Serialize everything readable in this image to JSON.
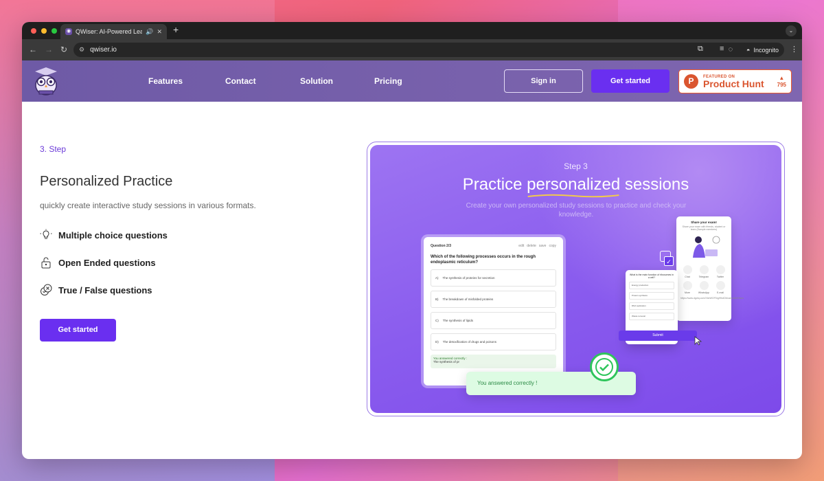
{
  "browser": {
    "tab_title": "QWiser: AI-Powered Learn",
    "url": "qwiser.io",
    "incognito_label": "Incognito"
  },
  "nav": {
    "links": [
      "Features",
      "Contact",
      "Solution",
      "Pricing"
    ],
    "signin": "Sign in",
    "get_started": "Get started",
    "product_hunt": {
      "featured": "FEATURED ON",
      "name": "Product Hunt",
      "votes": "795"
    }
  },
  "main": {
    "step": "3. Step",
    "title": "Personalized Practice",
    "description": "quickly create interactive study sessions in various formats.",
    "features": [
      "Multiple choice questions",
      "Open Ended questions",
      "True / False questions"
    ],
    "cta": "Get started"
  },
  "showcase": {
    "step": "Step 3",
    "title_pre": "Practice ",
    "title_highlight": "personalized",
    "title_post": " sessions",
    "subtitle": "Create your own personalized study sessions to practice and check your knowledge.",
    "quiz": {
      "question_num": "Question 2/3",
      "tools": [
        "edit",
        "delete",
        "save",
        "copy"
      ],
      "question": "Which of the following processes occurs in the rough endoplasmic reticulum?",
      "options": [
        {
          "letter": "A)",
          "text": "The synthesis of proteins for secretion"
        },
        {
          "letter": "B)",
          "text": "The breakdown of misfolded proteins"
        },
        {
          "letter": "C)",
          "text": "The synthesis of lipids"
        },
        {
          "letter": "D)",
          "text": "The detoxification of drugs and poisons"
        }
      ],
      "result_line1": "You answered correctly :",
      "result_line2": "The synthesis of pr"
    },
    "toast": "You answered correctly !",
    "share": {
      "title": "Share your exam!",
      "subtitle": "Share your exam with friends, student or team (Sample members)",
      "buttons": [
        "Chat",
        "Telegram",
        "Twitter",
        "More",
        "WhatsApp",
        "E-mail"
      ],
      "link": "https://www.dgdrq.com/XbeWOF5rg9fhdCMcaeertAfrE8ses"
    },
    "mini": {
      "question": "What is the main function of ribosomes in a cell?",
      "options": [
        "Energy production",
        "Protein synthesis",
        "DNA replication",
        "Waste removal"
      ]
    },
    "submit": "Submit"
  },
  "colors": {
    "accent": "#6a2ff0",
    "nav_bg": "#7560ab",
    "success": "#2ec55b"
  }
}
